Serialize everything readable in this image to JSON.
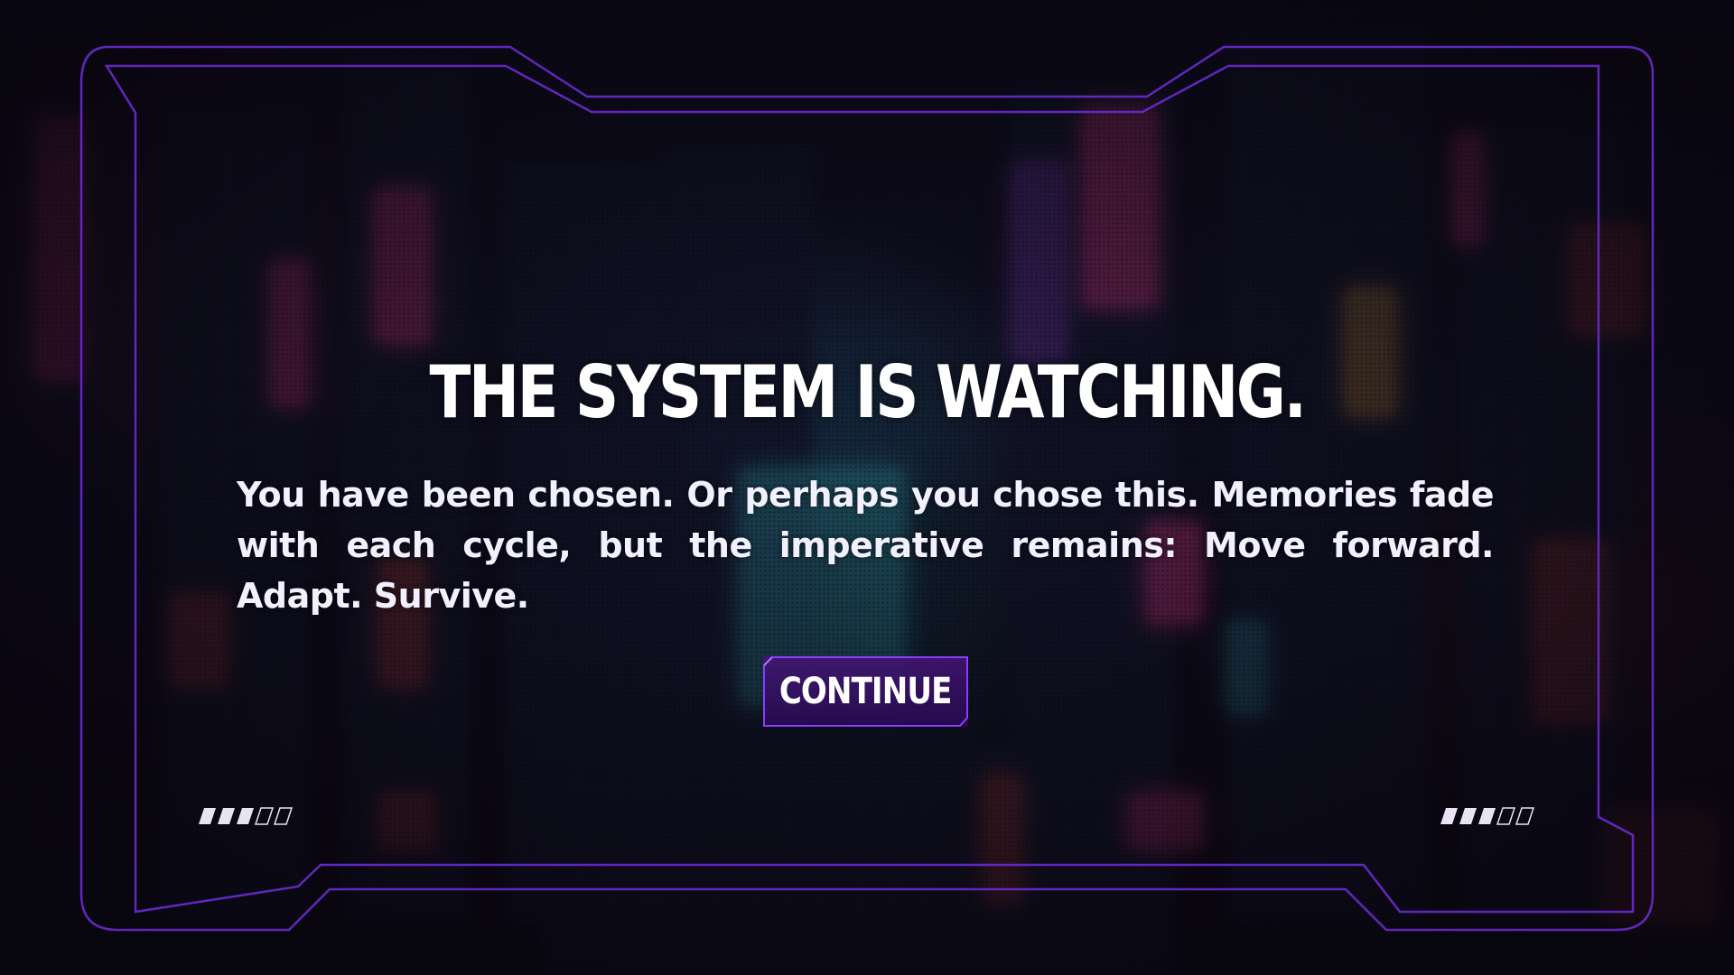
{
  "screen": {
    "title": "THE SYSTEM IS WATCHING.",
    "body": "You have been chosen. Or perhaps you chose this. Memories fade with each cycle, but the imperative remains: Move forward. Adapt. Survive.",
    "continue_label": "CONTINUE"
  },
  "indicators": {
    "left_filled": 3,
    "right_filled": 3,
    "total": 5
  },
  "colors": {
    "frame": "#6a2bd0",
    "button_fill": "#3b1270",
    "button_border": "#8a3cff",
    "text": "#ffffff"
  }
}
